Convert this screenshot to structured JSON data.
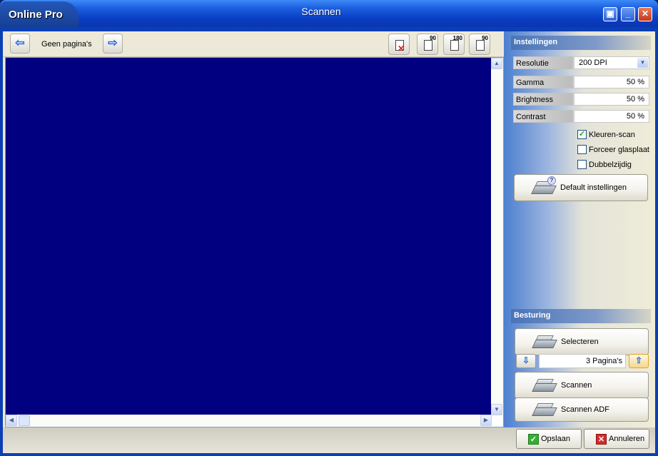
{
  "window": {
    "app_name": "Online Pro",
    "title": "Scannen",
    "controls": {
      "restore": "▣",
      "minimize": "_",
      "close": "✕"
    }
  },
  "toolbar": {
    "prev_icon": "arrow-left-icon",
    "next_icon": "arrow-right-icon",
    "page_label": "Geen pagina's",
    "tools": [
      {
        "name": "delete-page",
        "badge": ""
      },
      {
        "name": "rotate-90-right",
        "badge": "90"
      },
      {
        "name": "rotate-180",
        "badge": "180"
      },
      {
        "name": "rotate-90-left",
        "badge": "90"
      }
    ]
  },
  "preview": {
    "background": "#010080"
  },
  "settings": {
    "header": "Instellingen",
    "resolution": {
      "label": "Resolutie",
      "value": "200 DPI"
    },
    "gamma": {
      "label": "Gamma",
      "value": "50 %"
    },
    "brightness": {
      "label": "Brightness",
      "value": "50 %"
    },
    "contrast": {
      "label": "Contrast",
      "value": "50 %"
    },
    "checkboxes": [
      {
        "label": "Kleuren-scan",
        "checked": true
      },
      {
        "label": "Forceer glasplaat",
        "checked": false
      },
      {
        "label": "Dubbelzijdig",
        "checked": false
      }
    ],
    "default_button": "Default instellingen"
  },
  "control": {
    "header": "Besturing",
    "select_button": "Selecteren",
    "pages_value": "3 Pagina's",
    "scan_button": "Scannen",
    "scan_adf_button": "Scannen ADF"
  },
  "footer": {
    "save_button": "Opslaan",
    "cancel_button": "Annuleren"
  },
  "colors": {
    "title_bar": "#0a3dc2",
    "preview_bg": "#010080",
    "ok_green": "#33b033",
    "cancel_red": "#d62b2b"
  }
}
